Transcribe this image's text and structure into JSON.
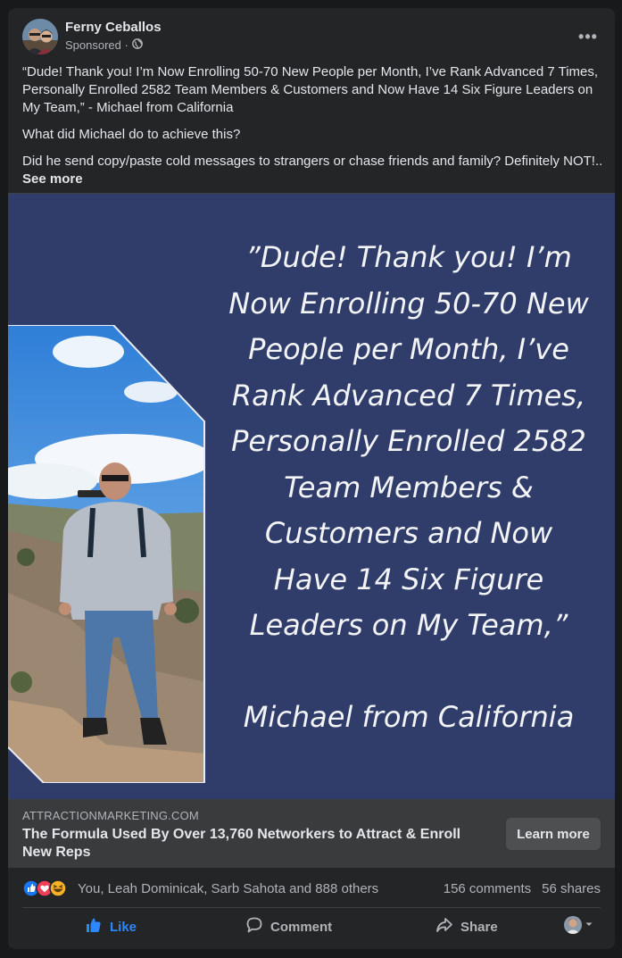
{
  "post": {
    "author": "Ferny Ceballos",
    "sponsored": "Sponsored ·",
    "text": {
      "p1": "“Dude! Thank you! I’m Now Enrolling 50-70 New People per Month, I’ve Rank Advanced 7 Times, Personally Enrolled 2582 Team Members & Customers and Now Have 14 Six Figure Leaders on My Team,” - Michael from California",
      "p2": "What did Michael do to achieve this?",
      "p3": "Did he send copy/paste cold messages to strangers or chase friends and family? Definitely NOT!...",
      "see_more": "See more"
    }
  },
  "creative": {
    "background": "#303d6b",
    "quote_lines": [
      "”Dude! Thank you! I’m",
      "Now Enrolling 50-70 New",
      "People per Month, I’ve",
      "Rank Advanced 7 Times,",
      "Personally Enrolled 2582",
      "Team Members &",
      "Customers and Now",
      "Have 14 Six Figure",
      "Leaders on My Team,”"
    ],
    "signature": "Michael from California"
  },
  "link": {
    "domain": "ATTRACTIONMARKETING.COM",
    "headline": "The Formula Used By Over 13,760 Networkers to Attract & Enroll New Reps",
    "cta": "Learn more"
  },
  "stats": {
    "reactions_text": "You, Leah Dominicak, Sarb Sahota and 888 others",
    "comments": "156 comments",
    "shares": "56 shares"
  },
  "actions": {
    "like": "Like",
    "comment": "Comment",
    "share": "Share"
  },
  "icons": [
    "globe-icon",
    "more-icon",
    "like-reaction-icon",
    "love-reaction-icon",
    "haha-reaction-icon",
    "like-icon",
    "comment-icon",
    "share-icon",
    "chevron-down-icon"
  ],
  "colors": {
    "accent": "#2d88ff",
    "card": "#242526",
    "link_bar": "#3a3b3c"
  }
}
